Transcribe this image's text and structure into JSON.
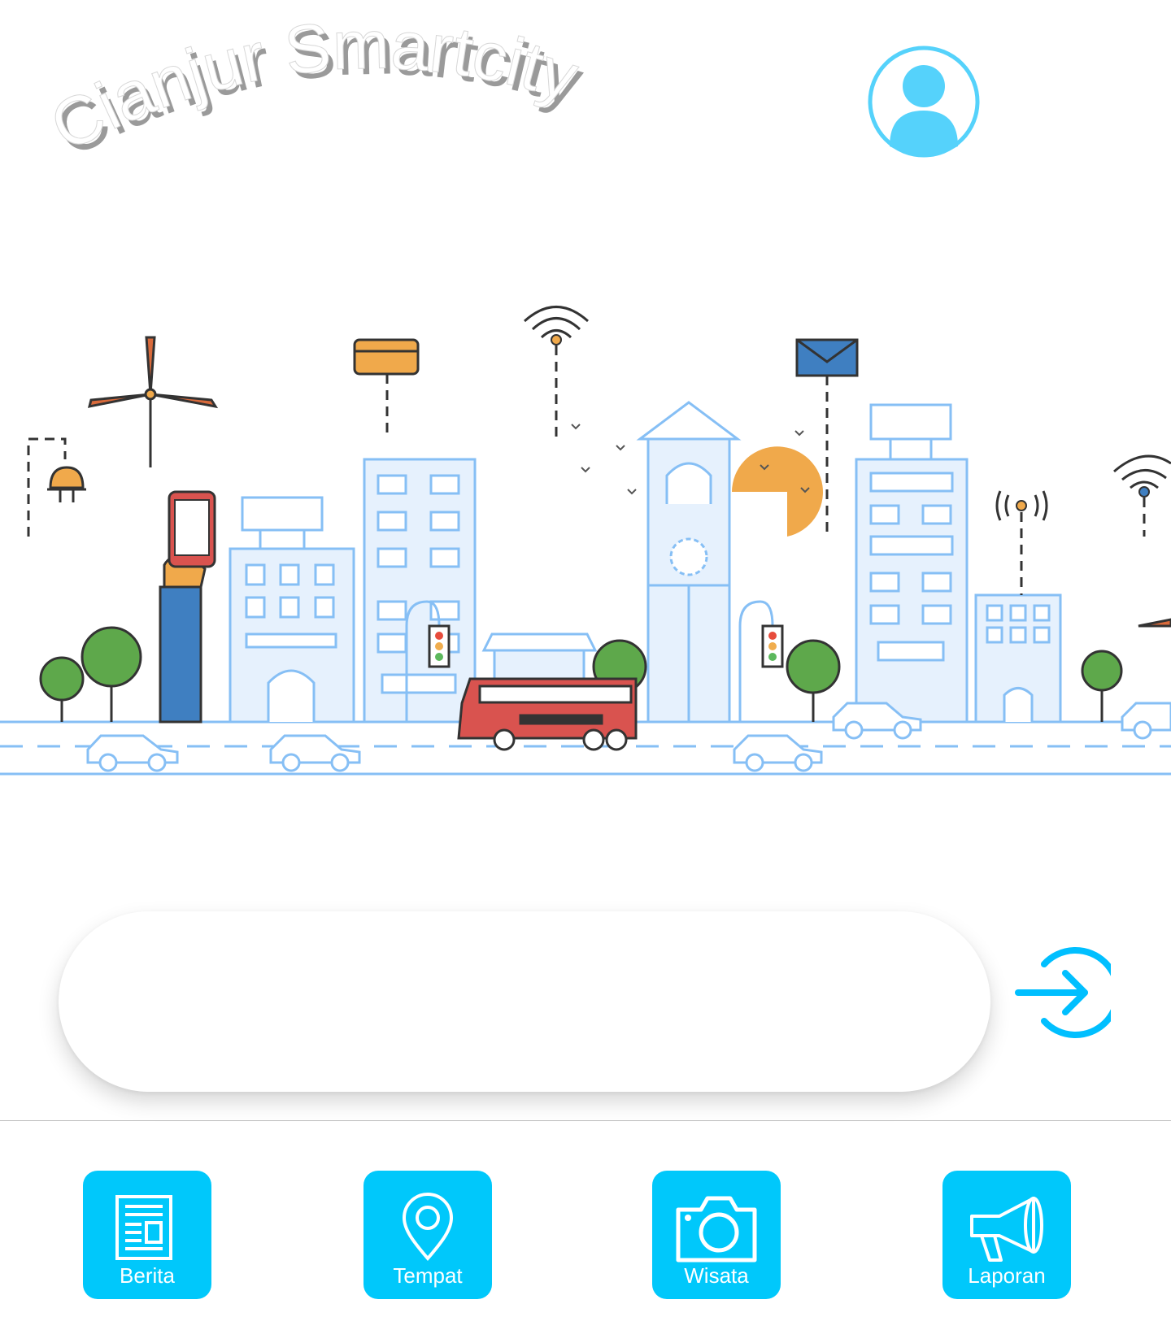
{
  "app": {
    "title": "Cianjur Smartcity"
  },
  "header": {
    "avatar_icon": "user-avatar-icon"
  },
  "search": {
    "placeholder": "",
    "value": "",
    "submit_icon": "arrow-right-circle-icon"
  },
  "menu": [
    {
      "label": "Berita",
      "icon": "newspaper-icon"
    },
    {
      "label": "Tempat",
      "icon": "map-pin-icon"
    },
    {
      "label": "Wisata",
      "icon": "camera-icon"
    },
    {
      "label": "Laporan",
      "icon": "megaphone-icon"
    }
  ],
  "colors": {
    "accent": "#00c8fb",
    "avatar": "#55d2fb",
    "title_shadow": "#9a9a9a",
    "bus": "#d9534f"
  }
}
